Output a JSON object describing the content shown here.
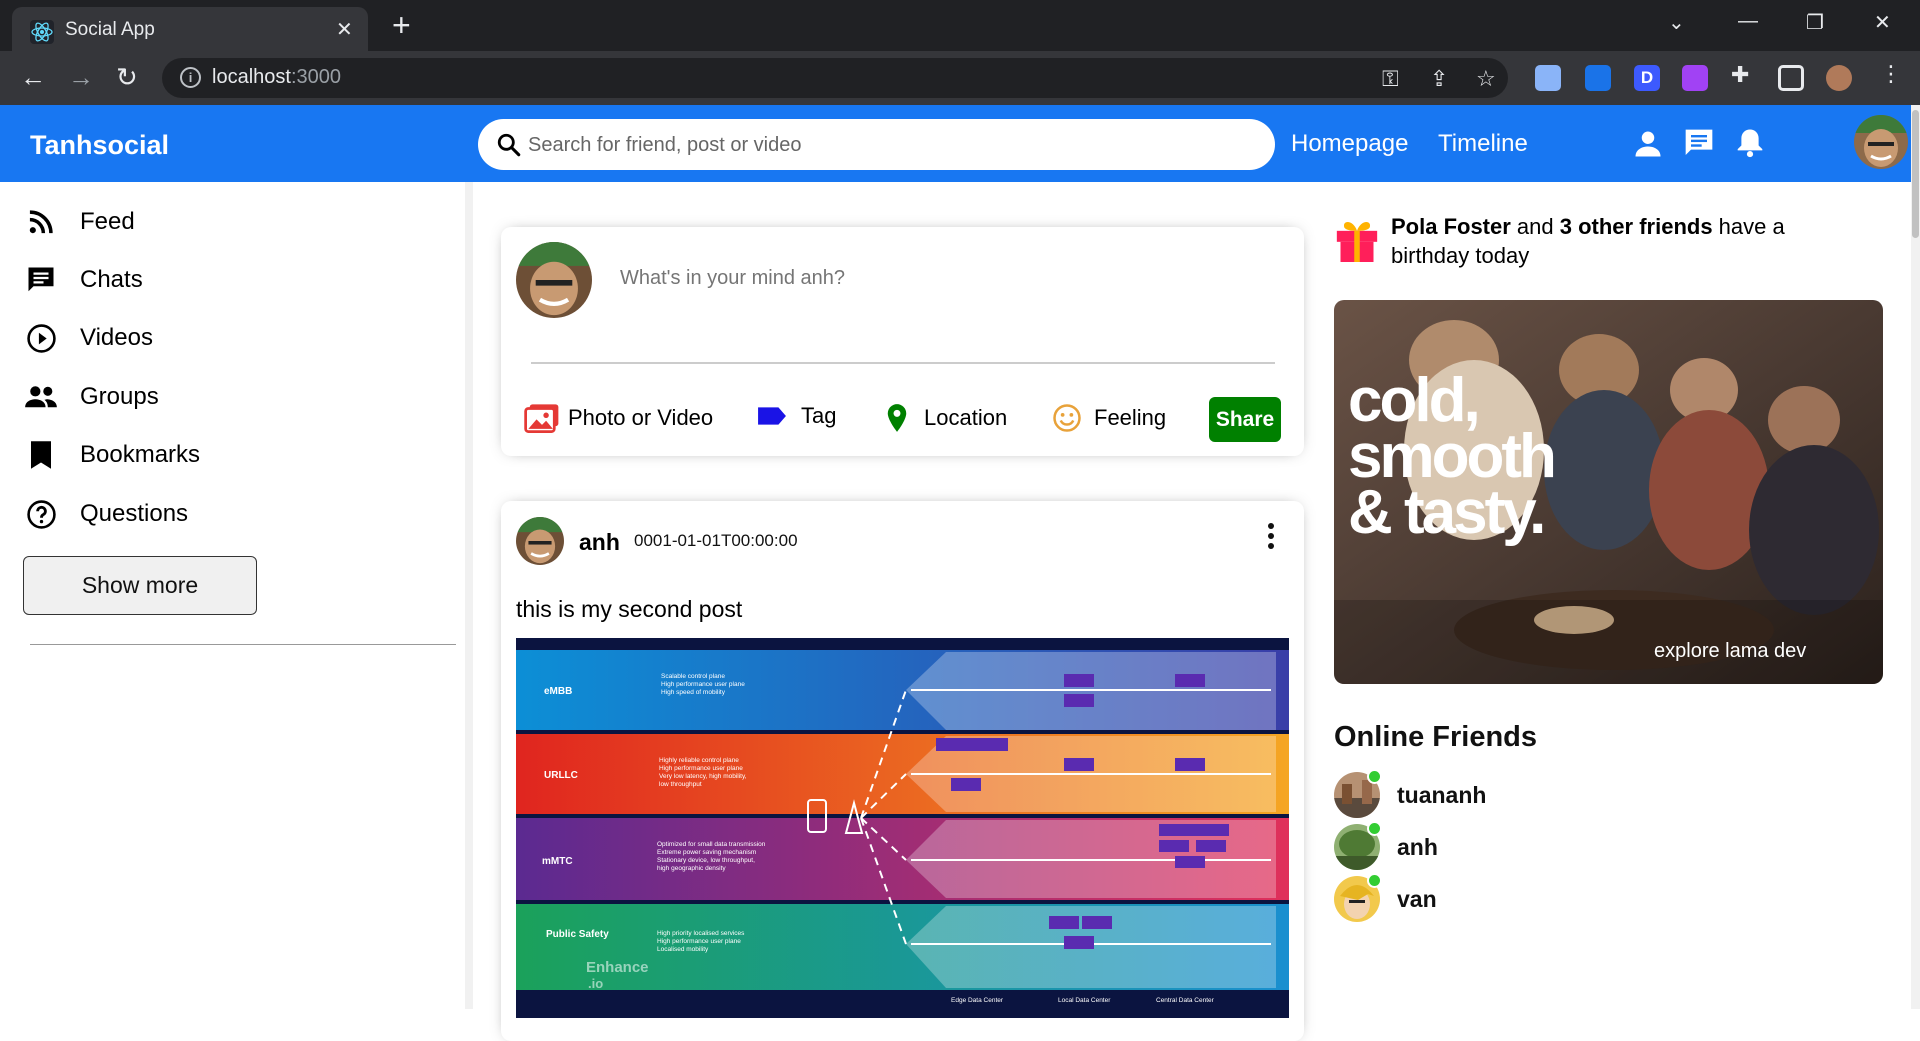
{
  "browser": {
    "tab_title": "Social App",
    "url_host": "localhost",
    "url_port": ":3000"
  },
  "header": {
    "logo": "Tanhsocial",
    "search_placeholder": "Search for friend, post or video",
    "nav_links": [
      "Homepage",
      "Timeline"
    ]
  },
  "sidebar": {
    "items": [
      {
        "label": "Feed",
        "icon": "rss-feed-icon"
      },
      {
        "label": "Chats",
        "icon": "chat-icon"
      },
      {
        "label": "Videos",
        "icon": "play-circle-icon"
      },
      {
        "label": "Groups",
        "icon": "group-icon"
      },
      {
        "label": "Bookmarks",
        "icon": "bookmark-icon"
      },
      {
        "label": "Questions",
        "icon": "help-circle-icon"
      }
    ],
    "show_more": "Show more"
  },
  "composer": {
    "placeholder": "What's in your mind anh?",
    "options": [
      {
        "label": "Photo or Video",
        "icon": "photo-icon",
        "color": "#e53935"
      },
      {
        "label": "Tag",
        "icon": "label-icon",
        "color": "#1a13e6"
      },
      {
        "label": "Location",
        "icon": "location-pin-icon",
        "color": "#008000"
      },
      {
        "label": "Feeling",
        "icon": "smiley-icon",
        "color": "#e8a23a"
      }
    ],
    "share_label": "Share"
  },
  "post": {
    "username": "anh",
    "date": "0001-01-01T00:00:00",
    "text": "this is my second post",
    "image": {
      "rows": [
        {
          "name": "eMBB",
          "lines": [
            "Scalable control plane",
            "High performance user plane",
            "High speed of mobility"
          ]
        },
        {
          "name": "URLLC",
          "lines": [
            "Highly reliable control plane",
            "High performance user plane",
            "Very low latency, high mobility,",
            "low throughput"
          ]
        },
        {
          "name": "mMTC",
          "lines": [
            "Optimized for small data transmission",
            "Extreme power saving mechanism",
            "Stationary device, low throughput,",
            "high geographic density"
          ]
        },
        {
          "name": "Public Safety",
          "lines": [
            "High priority localised services",
            "High performance user plane",
            "Localised mobility"
          ]
        }
      ],
      "footer": [
        "Edge Data Center",
        "Local Data Center",
        "Central Data Center"
      ],
      "watermark": "Enhance",
      "watermark_sub": ".io"
    }
  },
  "rightbar": {
    "birthday_name": "Pola Foster",
    "birthday_mid": " and ",
    "birthday_others": "3 other friends",
    "birthday_tail": " have a birthday today",
    "ad_lines": [
      "cold,",
      "smooth",
      "& tasty."
    ],
    "ad_footer": "explore lama dev",
    "online_title": "Online Friends",
    "friends": [
      "tuananh",
      "anh",
      "van"
    ],
    "online_color": "#32cd32"
  },
  "colors": {
    "brand": "#1877f2",
    "share": "#008000"
  }
}
